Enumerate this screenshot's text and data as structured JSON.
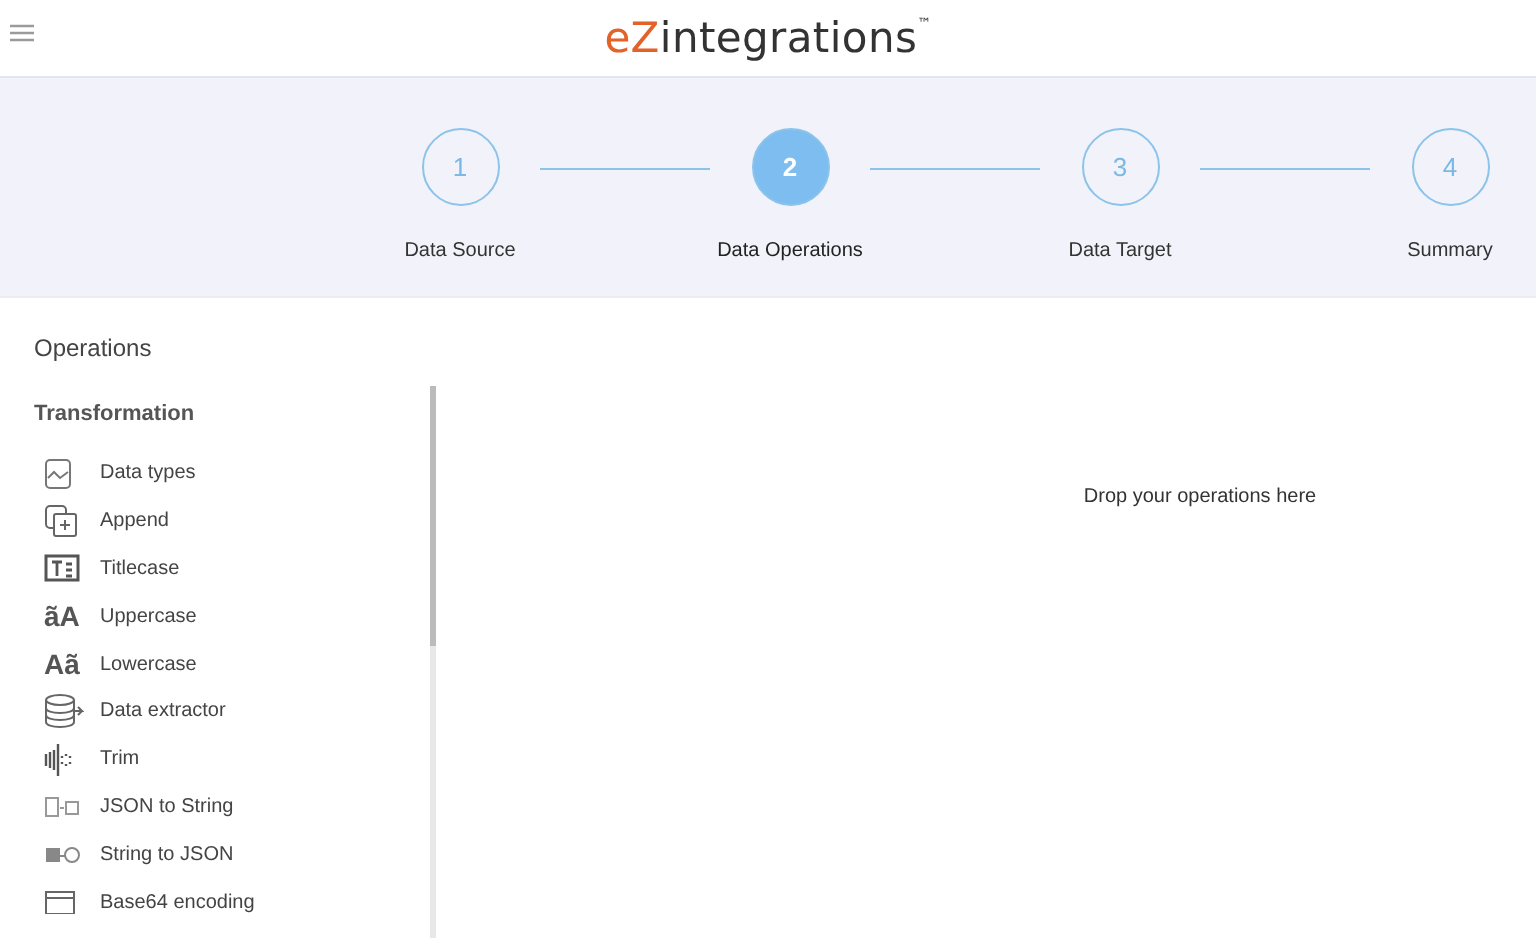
{
  "header": {
    "logo": {
      "accent": "eZ",
      "rest": "integrations",
      "mark": "™"
    }
  },
  "steps": [
    {
      "number": "1",
      "label": "Data Source",
      "selected": false
    },
    {
      "number": "2",
      "label": "Data Operations",
      "selected": true
    },
    {
      "number": "3",
      "label": "Data Target",
      "selected": false
    },
    {
      "number": "4",
      "label": "Summary",
      "selected": false
    }
  ],
  "sidebar": {
    "title": "Operations",
    "section": "Transformation",
    "items": [
      {
        "label": "Data types"
      },
      {
        "label": "Append"
      },
      {
        "label": "Titlecase"
      },
      {
        "label": "Uppercase",
        "glyph": "ãA"
      },
      {
        "label": "Lowercase",
        "glyph": "Aã"
      },
      {
        "label": "Data extractor"
      },
      {
        "label": "Trim"
      },
      {
        "label": "JSON to String"
      },
      {
        "label": "String to JSON"
      },
      {
        "label": "Base64 encoding"
      }
    ]
  },
  "canvas": {
    "placeholder": "Drop your operations here"
  }
}
